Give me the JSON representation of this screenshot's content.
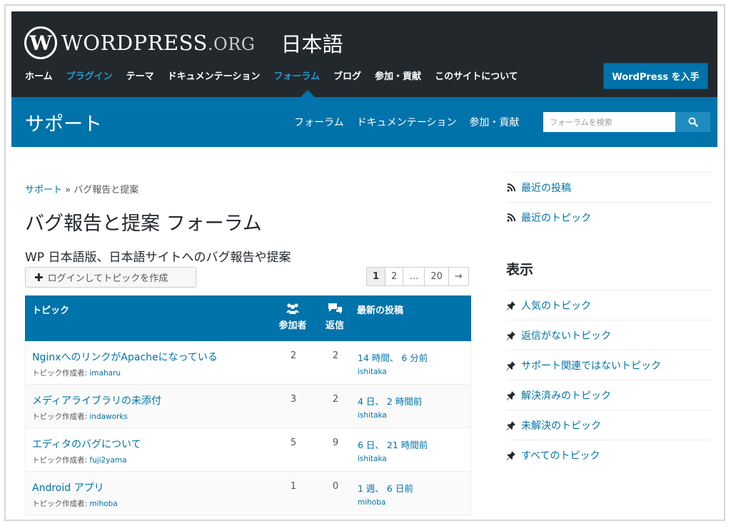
{
  "header": {
    "logo_word": "WORDPRESS",
    "logo_org": ".ORG",
    "logo_lang": "日本語",
    "nav": [
      {
        "label": "ホーム",
        "accent": false
      },
      {
        "label": "プラグイン",
        "accent": true
      },
      {
        "label": "テーマ",
        "accent": false
      },
      {
        "label": "ドキュメンテーション",
        "accent": false
      },
      {
        "label": "フォーラム",
        "accent": true
      },
      {
        "label": "ブログ",
        "accent": false
      },
      {
        "label": "参加・貢献",
        "accent": false
      },
      {
        "label": "このサイトについて",
        "accent": false
      }
    ],
    "get_wp_label": "WordPress を入手"
  },
  "subheader": {
    "title": "サポート",
    "nav": [
      "フォーラム",
      "ドキュメンテーション",
      "参加・貢献"
    ],
    "search_placeholder": "フォーラムを検索"
  },
  "breadcrumb": {
    "root": "サポート",
    "sep": " » ",
    "current": "バグ報告と提案"
  },
  "page": {
    "title": "バグ報告と提案 フォーラム",
    "description": "WP 日本語版、日本語サイトへのバグ報告や提案",
    "new_topic_label": "ログインしてトピックを作成"
  },
  "pagination": [
    "1",
    "2",
    "…",
    "20",
    "→"
  ],
  "table": {
    "headers": {
      "topic": "トピック",
      "participants": "参加者",
      "replies": "返信",
      "last_post": "最新の投稿"
    },
    "author_prefix": "トピック作成者: ",
    "rows": [
      {
        "title": "NginxへのリンクがApacheになっている",
        "author": "imaharu",
        "participants": "2",
        "replies": "2",
        "freshness": "14 時間、 6 分前",
        "last_user": "ishitaka"
      },
      {
        "title": "メディアライブラリの未添付",
        "author": "indaworks",
        "participants": "3",
        "replies": "2",
        "freshness": "4 日、 2 時間前",
        "last_user": "ishitaka"
      },
      {
        "title": "エディタのバグについて",
        "author": "fuji2yama",
        "participants": "5",
        "replies": "9",
        "freshness": "6 日、 21 時間前",
        "last_user": "ishitaka"
      },
      {
        "title": "Android アプリ",
        "author": "mihoba",
        "participants": "1",
        "replies": "0",
        "freshness": "1 週、 6 日前",
        "last_user": "mihoba"
      }
    ]
  },
  "sidebar": {
    "feeds": [
      "最近の投稿",
      "最近のトピック"
    ],
    "views_heading": "表示",
    "views": [
      "人気のトピック",
      "返信がないトピック",
      "サポート関連ではないトピック",
      "解決済みのトピック",
      "未解決のトピック",
      "すべてのトピック"
    ]
  },
  "colors": {
    "header_bg": "#23282d",
    "brand_blue": "#0073aa",
    "link": "#0073aa",
    "nav_accent": "#1e9ad6"
  },
  "icons": {
    "feed": "rss-icon",
    "view": "pin-icon",
    "participants": "people-icon",
    "replies": "chat-icon",
    "search": "search-icon"
  }
}
